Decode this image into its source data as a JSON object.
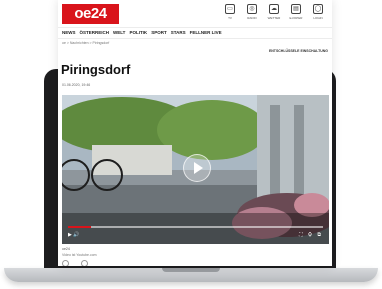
{
  "brand": {
    "logo_text": "oe24",
    "accent_color": "#d9141b"
  },
  "header_icons": [
    {
      "icon": "tv-icon",
      "label": "TV"
    },
    {
      "icon": "radio-icon",
      "label": "RADIO"
    },
    {
      "icon": "weather-icon",
      "label": "WETTER"
    },
    {
      "icon": "epaper-icon",
      "label": "E-PAPER"
    },
    {
      "icon": "login-icon",
      "label": "LOGIN"
    }
  ],
  "nav": [
    "NEWS",
    "ÖSTERREICH",
    "WELT",
    "POLITIK",
    "SPORT",
    "STARS",
    "FELLNER LIVE"
  ],
  "breadcrumb": "oe > Nachrichten > Piringsdorf",
  "settings_link": "ENTSCHLÜSSELE EINSCHALTUNG",
  "article": {
    "title": "Piringsdorf",
    "date": "01.06.2020, 19:46"
  },
  "video": {
    "progress": 0.09,
    "controls_left": "▶  🔊",
    "controls_right": "⛶ ⚙ ⧉"
  },
  "caption": "oe24",
  "credit": "Video ist Youtube.com"
}
